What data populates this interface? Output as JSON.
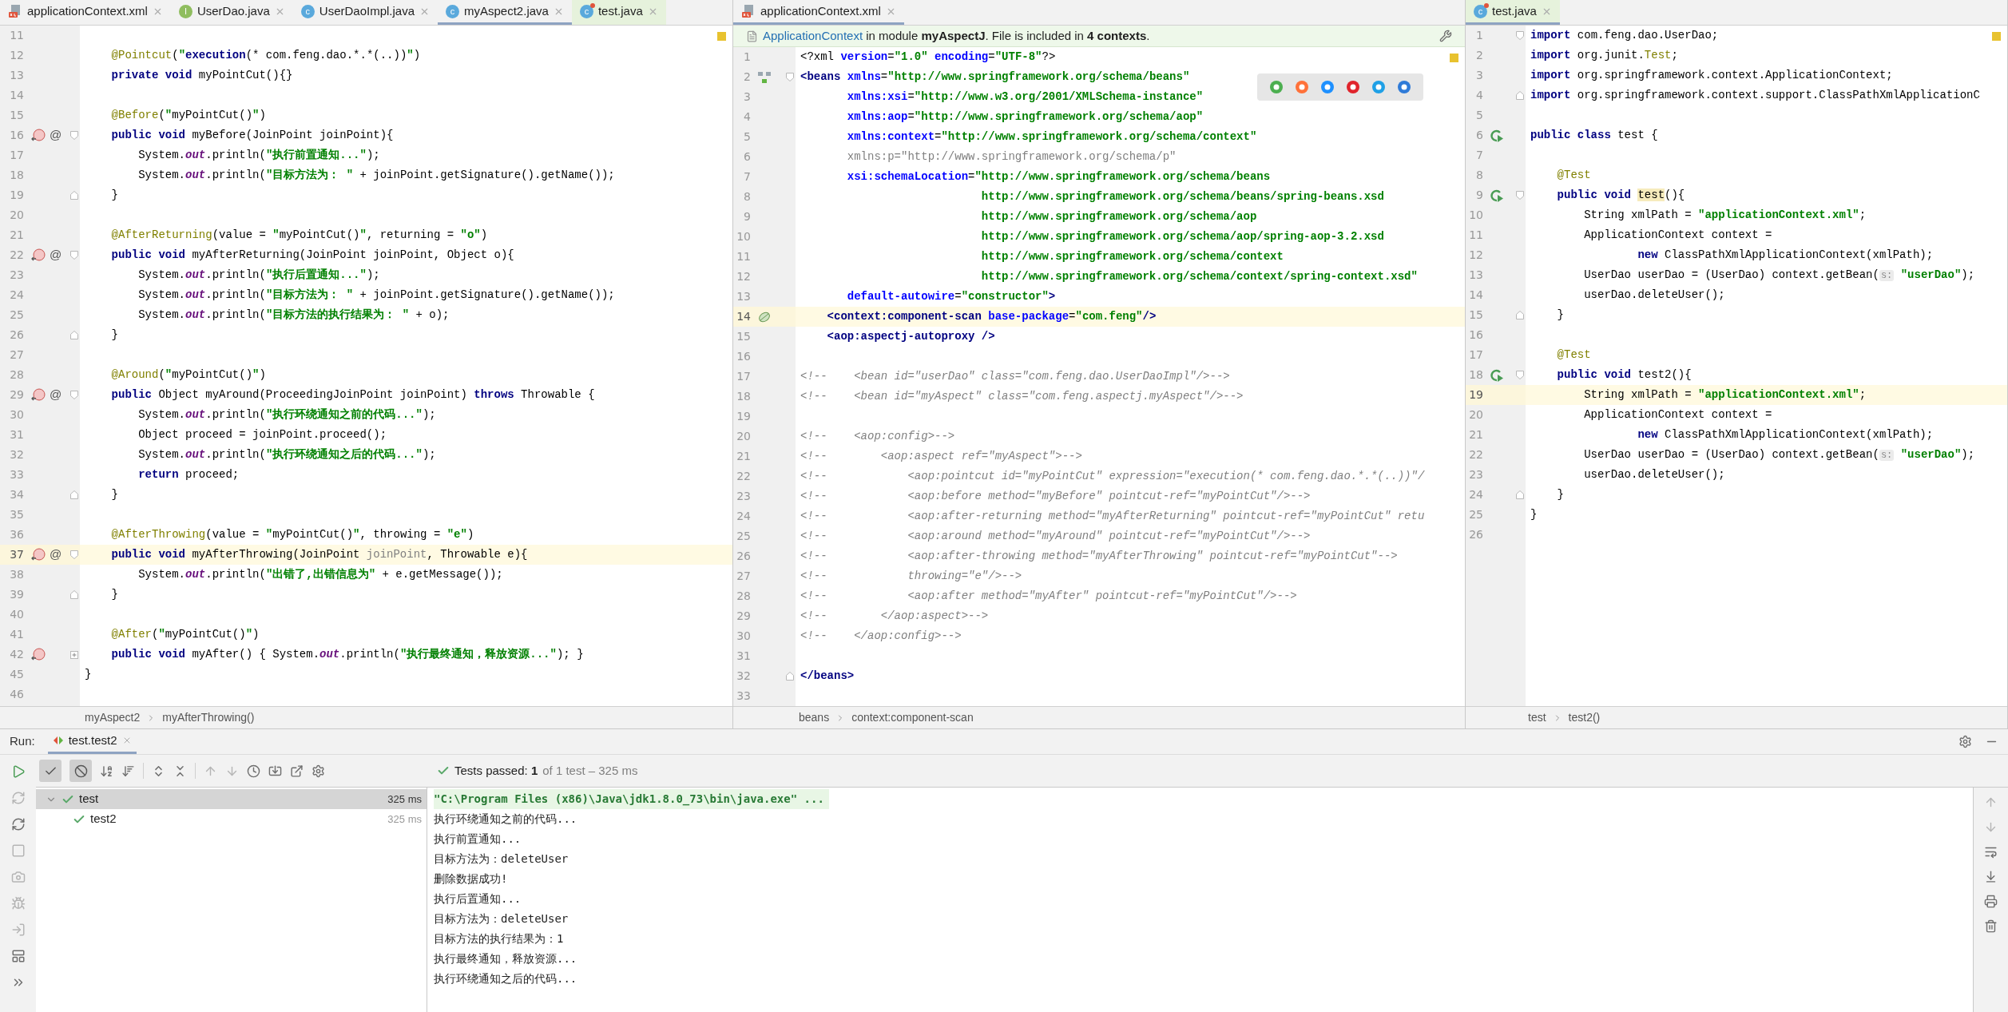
{
  "editors": [
    {
      "tabs": [
        {
          "name": "applicationContext.xml",
          "kind": "xml",
          "color": "#f2f2f2",
          "selected": false
        },
        {
          "name": "UserDao.java",
          "kind": "interface",
          "badge": "I",
          "color": "#f2f2f2",
          "selected": false
        },
        {
          "name": "UserDaoImpl.java",
          "kind": "class",
          "badge": "c",
          "color": "#f2f2f2",
          "selected": false
        },
        {
          "name": "myAspect2.java",
          "kind": "class",
          "badge": "c",
          "color": "#f2f2f2",
          "selected": true
        },
        {
          "name": "test.java",
          "kind": "test-class",
          "badge": "c",
          "color": "#e6f2dc",
          "selected": false
        }
      ],
      "lines": [
        {
          "n": "11",
          "current": false
        },
        {
          "n": "12",
          "current": false,
          "tokens": [
            {
              "kind": "ann",
              "text": "    @Pointcut"
            },
            {
              "kind": "plain",
              "text": "("
            },
            {
              "kind": "str",
              "text": "\""
            },
            {
              "kind": "kw",
              "text": "execution"
            },
            {
              "kind": "plain",
              "text": "(* com.feng.dao.*.*(..))"
            },
            {
              "kind": "str",
              "text": "\""
            },
            {
              "kind": "plain",
              "text": ")"
            }
          ]
        },
        {
          "n": "13",
          "current": false,
          "tokens": [
            {
              "kind": "kw",
              "text": "    private void "
            },
            {
              "kind": "plain",
              "text": "myPointCut(){}"
            }
          ]
        },
        {
          "n": "14",
          "current": false
        },
        {
          "n": "15",
          "current": false,
          "tokens": [
            {
              "kind": "ann",
              "text": "    @Before"
            },
            {
              "kind": "plain",
              "text": "("
            },
            {
              "kind": "str",
              "text": "\""
            },
            {
              "kind": "plain",
              "text": "myPointCut()"
            },
            {
              "kind": "str",
              "text": "\""
            },
            {
              "kind": "plain",
              "text": ")"
            }
          ]
        },
        {
          "n": "16",
          "current": false,
          "gutter": {
            "kind": "override"
          },
          "advice_mark": "@",
          "fold": {
            "kind": "open"
          },
          "tokens": [
            {
              "kind": "kw",
              "text": "    public void "
            },
            {
              "kind": "plain",
              "text": "myBefore(JoinPoint joinPoint){"
            }
          ]
        },
        {
          "n": "17",
          "current": false,
          "tokens": [
            {
              "kind": "plain",
              "text": "        System."
            },
            {
              "kind": "field",
              "text": "out"
            },
            {
              "kind": "plain",
              "text": ".println("
            },
            {
              "kind": "str",
              "text": "\"执行前置通知...\""
            },
            {
              "kind": "plain",
              "text": ");"
            }
          ]
        },
        {
          "n": "18",
          "current": false,
          "tokens": [
            {
              "kind": "plain",
              "text": "        System."
            },
            {
              "kind": "field",
              "text": "out"
            },
            {
              "kind": "plain",
              "text": ".println("
            },
            {
              "kind": "str",
              "text": "\"目标方法为： \""
            },
            {
              "kind": "plain",
              "text": " + joinPoint.getSignature().getName());"
            }
          ]
        },
        {
          "n": "19",
          "current": false,
          "fold": {
            "kind": "close"
          },
          "tokens": [
            {
              "kind": "plain",
              "text": "    }"
            }
          ]
        },
        {
          "n": "20",
          "current": false
        },
        {
          "n": "21",
          "current": false,
          "tokens": [
            {
              "kind": "ann",
              "text": "    @AfterReturning"
            },
            {
              "kind": "plain",
              "text": "(value = "
            },
            {
              "kind": "str",
              "text": "\""
            },
            {
              "kind": "plain",
              "text": "myPointCut()"
            },
            {
              "kind": "str",
              "text": "\""
            },
            {
              "kind": "plain",
              "text": ", returning = "
            },
            {
              "kind": "str",
              "text": "\"o\""
            },
            {
              "kind": "plain",
              "text": ")"
            }
          ]
        },
        {
          "n": "22",
          "current": false,
          "gutter": {
            "kind": "override"
          },
          "advice_mark": "@",
          "fold": {
            "kind": "open"
          },
          "tokens": [
            {
              "kind": "kw",
              "text": "    public void "
            },
            {
              "kind": "plain",
              "text": "myAfterReturning(JoinPoint joinPoint, Object o){"
            }
          ]
        },
        {
          "n": "23",
          "current": false,
          "tokens": [
            {
              "kind": "plain",
              "text": "        System."
            },
            {
              "kind": "field",
              "text": "out"
            },
            {
              "kind": "plain",
              "text": ".println("
            },
            {
              "kind": "str",
              "text": "\"执行后置通知...\""
            },
            {
              "kind": "plain",
              "text": ");"
            }
          ]
        },
        {
          "n": "24",
          "current": false,
          "tokens": [
            {
              "kind": "plain",
              "text": "        System."
            },
            {
              "kind": "field",
              "text": "out"
            },
            {
              "kind": "plain",
              "text": ".println("
            },
            {
              "kind": "str",
              "text": "\"目标方法为： \""
            },
            {
              "kind": "plain",
              "text": " + joinPoint.getSignature().getName());"
            }
          ]
        },
        {
          "n": "25",
          "current": false,
          "tokens": [
            {
              "kind": "plain",
              "text": "        System."
            },
            {
              "kind": "field",
              "text": "out"
            },
            {
              "kind": "plain",
              "text": ".println("
            },
            {
              "kind": "str",
              "text": "\"目标方法的执行结果为： \""
            },
            {
              "kind": "plain",
              "text": " + o);"
            }
          ]
        },
        {
          "n": "26",
          "current": false,
          "fold": {
            "kind": "close"
          },
          "tokens": [
            {
              "kind": "plain",
              "text": "    }"
            }
          ]
        },
        {
          "n": "27",
          "current": false
        },
        {
          "n": "28",
          "current": false,
          "tokens": [
            {
              "kind": "ann",
              "text": "    @Around"
            },
            {
              "kind": "plain",
              "text": "("
            },
            {
              "kind": "str",
              "text": "\""
            },
            {
              "kind": "plain",
              "text": "myPointCut()"
            },
            {
              "kind": "str",
              "text": "\""
            },
            {
              "kind": "plain",
              "text": ")"
            }
          ]
        },
        {
          "n": "29",
          "current": false,
          "gutter": {
            "kind": "override"
          },
          "advice_mark": "@",
          "fold": {
            "kind": "open"
          },
          "tokens": [
            {
              "kind": "kw",
              "text": "    public "
            },
            {
              "kind": "plain",
              "text": "Object myAround(ProceedingJoinPoint joinPoint) "
            },
            {
              "kind": "kw",
              "text": "throws"
            },
            {
              "kind": "plain",
              "text": " Throwable {"
            }
          ]
        },
        {
          "n": "30",
          "current": false,
          "tokens": [
            {
              "kind": "plain",
              "text": "        System."
            },
            {
              "kind": "field",
              "text": "out"
            },
            {
              "kind": "plain",
              "text": ".println("
            },
            {
              "kind": "str",
              "text": "\"执行环绕通知之前的代码...\""
            },
            {
              "kind": "plain",
              "text": ");"
            }
          ]
        },
        {
          "n": "31",
          "current": false,
          "tokens": [
            {
              "kind": "plain",
              "text": "        Object proceed = joinPoint.proceed();"
            }
          ]
        },
        {
          "n": "32",
          "current": false,
          "tokens": [
            {
              "kind": "plain",
              "text": "        System."
            },
            {
              "kind": "field",
              "text": "out"
            },
            {
              "kind": "plain",
              "text": ".println("
            },
            {
              "kind": "str",
              "text": "\"执行环绕通知之后的代码...\""
            },
            {
              "kind": "plain",
              "text": ");"
            }
          ]
        },
        {
          "n": "33",
          "current": false,
          "tokens": [
            {
              "kind": "kw",
              "text": "        return"
            },
            {
              "kind": "plain",
              "text": " proceed;"
            }
          ]
        },
        {
          "n": "34",
          "current": false,
          "fold": {
            "kind": "close"
          },
          "tokens": [
            {
              "kind": "plain",
              "text": "    }"
            }
          ]
        },
        {
          "n": "35",
          "current": false
        },
        {
          "n": "36",
          "current": false,
          "tokens": [
            {
              "kind": "ann",
              "text": "    @AfterThrowing"
            },
            {
              "kind": "plain",
              "text": "(value = "
            },
            {
              "kind": "str",
              "text": "\""
            },
            {
              "kind": "plain",
              "text": "myPointCut()"
            },
            {
              "kind": "str",
              "text": "\""
            },
            {
              "kind": "plain",
              "text": ", throwing = "
            },
            {
              "kind": "str",
              "text": "\"e\""
            },
            {
              "kind": "plain",
              "text": ")"
            }
          ]
        },
        {
          "n": "37",
          "current": true,
          "gutter": {
            "kind": "override"
          },
          "advice_mark": "@",
          "fold": {
            "kind": "open"
          },
          "tokens": [
            {
              "kind": "kw",
              "text": "    public void "
            },
            {
              "kind": "plain",
              "text": "myAfterThrowing(JoinPoint "
            },
            {
              "kind": "unused",
              "text": "joinPoint"
            },
            {
              "kind": "plain",
              "text": ", Throwable e){"
            }
          ]
        },
        {
          "n": "38",
          "current": false,
          "tokens": [
            {
              "kind": "plain",
              "text": "        System."
            },
            {
              "kind": "field",
              "text": "out"
            },
            {
              "kind": "plain",
              "text": ".println("
            },
            {
              "kind": "str",
              "text": "\"出错了,出错信息为\""
            },
            {
              "kind": "plain",
              "text": " + e.getMessage());"
            }
          ]
        },
        {
          "n": "39",
          "current": false,
          "fold": {
            "kind": "close"
          },
          "tokens": [
            {
              "kind": "plain",
              "text": "    }"
            }
          ]
        },
        {
          "n": "40",
          "current": false
        },
        {
          "n": "41",
          "current": false,
          "tokens": [
            {
              "kind": "ann",
              "text": "    @After"
            },
            {
              "kind": "plain",
              "text": "("
            },
            {
              "kind": "str",
              "text": "\""
            },
            {
              "kind": "plain",
              "text": "myPointCut()"
            },
            {
              "kind": "str",
              "text": "\""
            },
            {
              "kind": "plain",
              "text": ")"
            }
          ]
        },
        {
          "n": "42",
          "current": false,
          "gutter": {
            "kind": "override"
          },
          "fold": {
            "kind": "collapsed"
          },
          "tokens": [
            {
              "kind": "kw",
              "text": "    public void "
            },
            {
              "kind": "plain",
              "text": "myAfter() { System."
            },
            {
              "kind": "field",
              "text": "out"
            },
            {
              "kind": "plain",
              "text": ".println("
            },
            {
              "kind": "str",
              "text": "\"执行最终通知，释放资源...\""
            },
            {
              "kind": "plain",
              "text": "); }"
            }
          ]
        },
        {
          "n": "45",
          "current": false,
          "tokens": [
            {
              "kind": "plain",
              "text": "}"
            }
          ]
        },
        {
          "n": "46",
          "current": false
        }
      ],
      "breadcrumbs": [
        "myAspect2",
        "myAfterThrowing()"
      ]
    },
    {
      "tabs": [
        {
          "name": "applicationContext.xml",
          "kind": "xml",
          "color": "#f2f2f2",
          "selected": true
        }
      ],
      "notice": {
        "link": "ApplicationContext",
        "text": "in module **myAspectJ**. File is included in **4 contexts**."
      },
      "lines": [
        {
          "n": "1",
          "current": false,
          "tokens": [
            {
              "kind": "plain",
              "text": "<?xml "
            },
            {
              "kind": "attr",
              "text": "version"
            },
            {
              "kind": "plain",
              "text": "="
            },
            {
              "kind": "val",
              "text": "\"1.0\""
            },
            {
              "kind": "attr",
              "text": " encoding"
            },
            {
              "kind": "plain",
              "text": "="
            },
            {
              "kind": "val",
              "text": "\"UTF-8\""
            },
            {
              "kind": "plain",
              "text": "?>"
            }
          ]
        },
        {
          "n": "2",
          "current": false,
          "gutter": {
            "kind": "diagram"
          },
          "fold": {
            "kind": "open"
          },
          "tokens": [
            {
              "kind": "tag",
              "text": "<beans "
            },
            {
              "kind": "attr",
              "text": "xmlns"
            },
            {
              "kind": "plain",
              "text": "="
            },
            {
              "kind": "val",
              "text": "\"http://www.springframework.org/schema/beans\""
            }
          ]
        },
        {
          "n": "3",
          "current": false,
          "tokens": [
            {
              "kind": "attr",
              "text": "       xmlns:xsi"
            },
            {
              "kind": "plain",
              "text": "="
            },
            {
              "kind": "val",
              "text": "\"http://www.w3.org/2001/XMLSchema-instance\""
            }
          ]
        },
        {
          "n": "4",
          "current": false,
          "tokens": [
            {
              "kind": "attr",
              "text": "       xmlns:aop"
            },
            {
              "kind": "plain",
              "text": "="
            },
            {
              "kind": "val",
              "text": "\"http://www.springframework.org/schema/aop\""
            }
          ]
        },
        {
          "n": "5",
          "current": false,
          "tokens": [
            {
              "kind": "attr",
              "text": "       xmlns:context"
            },
            {
              "kind": "plain",
              "text": "="
            },
            {
              "kind": "val",
              "text": "\"http://www.springframework.org/schema/context\""
            }
          ]
        },
        {
          "n": "6",
          "current": false,
          "tokens": [
            {
              "kind": "ns",
              "text": "       xmlns:p=\"http://www.springframework.org/schema/p\""
            }
          ]
        },
        {
          "n": "7",
          "current": false,
          "tokens": [
            {
              "kind": "attr",
              "text": "       xsi:schemaLocation"
            },
            {
              "kind": "plain",
              "text": "="
            },
            {
              "kind": "val",
              "text": "\"http://www.springframework.org/schema/beans"
            }
          ]
        },
        {
          "n": "8",
          "current": false,
          "tokens": [
            {
              "kind": "val",
              "text": "                           http://www.springframework.org/schema/beans/spring-beans.xsd"
            }
          ]
        },
        {
          "n": "9",
          "current": false,
          "tokens": [
            {
              "kind": "val",
              "text": "                           http://www.springframework.org/schema/aop"
            }
          ]
        },
        {
          "n": "10",
          "current": false,
          "tokens": [
            {
              "kind": "val",
              "text": "                           http://www.springframework.org/schema/aop/spring-aop-3.2.xsd"
            }
          ]
        },
        {
          "n": "11",
          "current": false,
          "tokens": [
            {
              "kind": "val",
              "text": "                           http://www.springframework.org/schema/context"
            }
          ]
        },
        {
          "n": "12",
          "current": false,
          "tokens": [
            {
              "kind": "val",
              "text": "                           http://www.springframework.org/schema/context/spring-context.xsd\""
            }
          ]
        },
        {
          "n": "13",
          "current": false,
          "tokens": [
            {
              "kind": "attr",
              "text": "       default-autowire"
            },
            {
              "kind": "plain",
              "text": "="
            },
            {
              "kind": "val",
              "text": "\"constructor\""
            },
            {
              "kind": "tag",
              "text": ">"
            }
          ]
        },
        {
          "n": "14",
          "current": true,
          "gutter": {
            "kind": "bean"
          },
          "tokens": [
            {
              "kind": "tag",
              "text": "    <context:component-scan "
            },
            {
              "kind": "attr",
              "text": "base-package"
            },
            {
              "kind": "plain",
              "text": "="
            },
            {
              "kind": "val",
              "text": "\"com.feng\""
            },
            {
              "kind": "tag",
              "text": "/>"
            }
          ]
        },
        {
          "n": "15",
          "current": false,
          "tokens": [
            {
              "kind": "tag",
              "text": "    <aop:aspectj-autoproxy />"
            }
          ]
        },
        {
          "n": "16",
          "current": false
        },
        {
          "n": "17",
          "current": false,
          "tokens": [
            {
              "kind": "comment",
              "text": "<!--    <bean id=\"userDao\" class=\"com.feng.dao.UserDaoImpl\"/>-->"
            }
          ]
        },
        {
          "n": "18",
          "current": false,
          "tokens": [
            {
              "kind": "comment",
              "text": "<!--    <bean id=\"myAspect\" class=\"com.feng.aspectj.myAspect\"/>-->"
            }
          ]
        },
        {
          "n": "19",
          "current": false
        },
        {
          "n": "20",
          "current": false,
          "tokens": [
            {
              "kind": "comment",
              "text": "<!--    <aop:config>-->"
            }
          ]
        },
        {
          "n": "21",
          "current": false,
          "tokens": [
            {
              "kind": "comment",
              "text": "<!--        <aop:aspect ref=\"myAspect\">-->"
            }
          ]
        },
        {
          "n": "22",
          "current": false,
          "tokens": [
            {
              "kind": "comment",
              "text": "<!--            <aop:pointcut id=\"myPointCut\" expression=\"execution(* com.feng.dao.*.*(..))\"/"
            }
          ]
        },
        {
          "n": "23",
          "current": false,
          "tokens": [
            {
              "kind": "comment",
              "text": "<!--            <aop:before method=\"myBefore\" pointcut-ref=\"myPointCut\"/>-->"
            }
          ]
        },
        {
          "n": "24",
          "current": false,
          "tokens": [
            {
              "kind": "comment",
              "text": "<!--            <aop:after-returning method=\"myAfterReturning\" pointcut-ref=\"myPointCut\" retu"
            }
          ]
        },
        {
          "n": "25",
          "current": false,
          "tokens": [
            {
              "kind": "comment",
              "text": "<!--            <aop:around method=\"myAround\" pointcut-ref=\"myPointCut\"/>-->"
            }
          ]
        },
        {
          "n": "26",
          "current": false,
          "tokens": [
            {
              "kind": "comment",
              "text": "<!--            <aop:after-throwing method=\"myAfterThrowing\" pointcut-ref=\"myPointCut\"-->"
            }
          ]
        },
        {
          "n": "27",
          "current": false,
          "tokens": [
            {
              "kind": "comment",
              "text": "<!--            throwing=\"e\"/>-->"
            }
          ]
        },
        {
          "n": "28",
          "current": false,
          "tokens": [
            {
              "kind": "comment",
              "text": "<!--            <aop:after method=\"myAfter\" pointcut-ref=\"myPointCut\"/>-->"
            }
          ]
        },
        {
          "n": "29",
          "current": false,
          "tokens": [
            {
              "kind": "comment",
              "text": "<!--        </aop:aspect>-->"
            }
          ]
        },
        {
          "n": "30",
          "current": false,
          "tokens": [
            {
              "kind": "comment",
              "text": "<!--    </aop:config>-->"
            }
          ]
        },
        {
          "n": "31",
          "current": false
        },
        {
          "n": "32",
          "current": false,
          "fold": {
            "kind": "close"
          },
          "tokens": [
            {
              "kind": "tag",
              "text": "</beans>"
            }
          ]
        },
        {
          "n": "33",
          "current": false
        }
      ],
      "breadcrumbs": [
        "beans",
        "context:component-scan"
      ]
    },
    {
      "tabs": [
        {
          "name": "test.java",
          "kind": "test-class",
          "badge": "c",
          "color": "#e6f2dc",
          "selected": true
        }
      ],
      "lines": [
        {
          "n": "1",
          "current": false,
          "fold": {
            "kind": "open"
          },
          "tokens": [
            {
              "kind": "kw",
              "text": "import"
            },
            {
              "kind": "plain",
              "text": " com.feng.dao.UserDao;"
            }
          ]
        },
        {
          "n": "2",
          "current": false,
          "tokens": [
            {
              "kind": "kw",
              "text": "import"
            },
            {
              "kind": "plain",
              "text": " org.junit."
            },
            {
              "kind": "ann",
              "text": "Test"
            },
            {
              "kind": "plain",
              "text": ";"
            }
          ]
        },
        {
          "n": "3",
          "current": false,
          "tokens": [
            {
              "kind": "kw",
              "text": "import"
            },
            {
              "kind": "plain",
              "text": " org.springframework.context.ApplicationContext;"
            }
          ]
        },
        {
          "n": "4",
          "current": false,
          "fold": {
            "kind": "close"
          },
          "tokens": [
            {
              "kind": "kw",
              "text": "import"
            },
            {
              "kind": "plain",
              "text": " org.springframework.context.support.ClassPathXmlApplicationC"
            }
          ]
        },
        {
          "n": "5",
          "current": false
        },
        {
          "n": "6",
          "current": false,
          "gutter": {
            "kind": "run"
          },
          "tokens": [
            {
              "kind": "kw",
              "text": "public class "
            },
            {
              "kind": "plain",
              "text": "test {"
            }
          ]
        },
        {
          "n": "7",
          "current": false
        },
        {
          "n": "8",
          "current": false,
          "tokens": [
            {
              "kind": "ann",
              "text": "    @Test"
            }
          ]
        },
        {
          "n": "9",
          "current": false,
          "gutter": {
            "kind": "run"
          },
          "fold": {
            "kind": "open"
          },
          "tokens": [
            {
              "kind": "kw",
              "text": "    public void "
            },
            {
              "kind": "hl",
              "text": "test"
            },
            {
              "kind": "plain",
              "text": "(){"
            }
          ]
        },
        {
          "n": "10",
          "current": false,
          "tokens": [
            {
              "kind": "plain",
              "text": "        String xmlPath = "
            },
            {
              "kind": "str",
              "text": "\"applicationContext.xml\""
            },
            {
              "kind": "plain",
              "text": ";"
            }
          ]
        },
        {
          "n": "11",
          "current": false,
          "tokens": [
            {
              "kind": "plain",
              "text": "        ApplicationContext context ="
            }
          ]
        },
        {
          "n": "12",
          "current": false,
          "tokens": [
            {
              "kind": "kw",
              "text": "                new"
            },
            {
              "kind": "plain",
              "text": " ClassPathXmlApplicationContext(xmlPath);"
            }
          ]
        },
        {
          "n": "13",
          "current": false,
          "tokens": [
            {
              "kind": "plain",
              "text": "        UserDao userDao = (UserDao) context.getBean("
            },
            {
              "kind": "hint",
              "text": "s:"
            },
            {
              "kind": "str",
              "text": " \"userDao\""
            },
            {
              "kind": "plain",
              "text": ");"
            }
          ]
        },
        {
          "n": "14",
          "current": false,
          "tokens": [
            {
              "kind": "plain",
              "text": "        userDao.deleteUser();"
            }
          ]
        },
        {
          "n": "15",
          "current": false,
          "fold": {
            "kind": "close"
          },
          "tokens": [
            {
              "kind": "plain",
              "text": "    }"
            }
          ]
        },
        {
          "n": "16",
          "current": false
        },
        {
          "n": "17",
          "current": false,
          "tokens": [
            {
              "kind": "ann",
              "text": "    @Test"
            }
          ]
        },
        {
          "n": "18",
          "current": false,
          "gutter": {
            "kind": "run"
          },
          "fold": {
            "kind": "open"
          },
          "tokens": [
            {
              "kind": "kw",
              "text": "    public void "
            },
            {
              "kind": "plain",
              "text": "test2(){"
            }
          ]
        },
        {
          "n": "19",
          "current": true,
          "tokens": [
            {
              "kind": "plain",
              "text": "        String xmlPath = "
            },
            {
              "kind": "str",
              "text": "\"applicationContext.xml\""
            },
            {
              "kind": "plain",
              "text": ";"
            }
          ]
        },
        {
          "n": "20",
          "current": false,
          "tokens": [
            {
              "kind": "plain",
              "text": "        ApplicationContext context ="
            }
          ]
        },
        {
          "n": "21",
          "current": false,
          "tokens": [
            {
              "kind": "kw",
              "text": "                new"
            },
            {
              "kind": "plain",
              "text": " ClassPathXmlApplicationContext(xmlPath);"
            }
          ]
        },
        {
          "n": "22",
          "current": false,
          "tokens": [
            {
              "kind": "plain",
              "text": "        UserDao userDao = (UserDao) context.getBean("
            },
            {
              "kind": "hint",
              "text": "s:"
            },
            {
              "kind": "str",
              "text": " \"userDao\""
            },
            {
              "kind": "plain",
              "text": ");"
            }
          ]
        },
        {
          "n": "23",
          "current": false,
          "tokens": [
            {
              "kind": "plain",
              "text": "        userDao.deleteUser();"
            }
          ]
        },
        {
          "n": "24",
          "current": false,
          "fold": {
            "kind": "close"
          },
          "tokens": [
            {
              "kind": "plain",
              "text": "    }"
            }
          ]
        },
        {
          "n": "25",
          "current": false,
          "tokens": [
            {
              "kind": "plain",
              "text": "}"
            }
          ]
        },
        {
          "n": "26",
          "current": false
        }
      ],
      "breadcrumbs": [
        "test",
        "test2()"
      ]
    }
  ],
  "run": {
    "label": "Run:",
    "tab": {
      "name": "test.test2",
      "selected": true
    },
    "filters": [
      {
        "kind": "passed",
        "on": true
      },
      {
        "kind": "ignored",
        "on": true
      }
    ],
    "status": "Tests passed: **1**",
    "status_detail": "of 1 test – 325 ms",
    "tree": [
      {
        "name": "test",
        "time": "325 ms",
        "passed": true,
        "selected": true,
        "expanded": true,
        "children": [
          {
            "name": "test2",
            "time": "325 ms",
            "passed": true,
            "selected": false
          }
        ]
      }
    ],
    "console": [
      {
        "kind": "command",
        "text": "\"C:\\Program Files (x86)\\Java\\jdk1.8.0_73\\bin\\java.exe\" ..."
      },
      {
        "kind": "output",
        "text": "执行环绕通知之前的代码..."
      },
      {
        "kind": "output",
        "text": "执行前置通知..."
      },
      {
        "kind": "output",
        "text": "目标方法为：deleteUser"
      },
      {
        "kind": "output",
        "text": "删除数据成功!"
      },
      {
        "kind": "output",
        "text": "执行后置通知..."
      },
      {
        "kind": "output",
        "text": "目标方法为：deleteUser"
      },
      {
        "kind": "output",
        "text": "目标方法的执行结果为：1"
      },
      {
        "kind": "output",
        "text": "执行最终通知，释放资源..."
      },
      {
        "kind": "output",
        "text": "执行环绕通知之后的代码..."
      }
    ]
  }
}
